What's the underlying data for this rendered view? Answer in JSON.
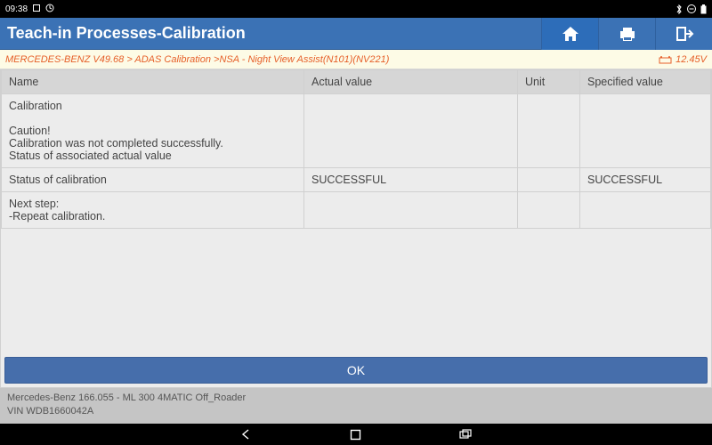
{
  "status_bar": {
    "time": "09:38",
    "bluetooth": true,
    "dnd": true,
    "battery": true
  },
  "title_bar": {
    "title": "Teach-in Processes-Calibration"
  },
  "breadcrumb": {
    "path": "MERCEDES-BENZ V49.68 > ADAS Calibration >NSA - Night View Assist(N101)(NV221)",
    "voltage": "12.45V"
  },
  "table": {
    "headers": {
      "name": "Name",
      "actual": "Actual value",
      "unit": "Unit",
      "spec": "Specified value"
    },
    "rows": [
      {
        "name": "Calibration\n\nCaution!\nCalibration was not completed successfully.\nStatus of associated actual value",
        "actual": "",
        "unit": "",
        "spec": ""
      },
      {
        "name": "Status of calibration",
        "actual": "SUCCESSFUL",
        "unit": "",
        "spec": "SUCCESSFUL"
      },
      {
        "name": "Next step:\n-Repeat calibration.",
        "actual": "",
        "unit": "",
        "spec": ""
      }
    ]
  },
  "buttons": {
    "ok": "OK"
  },
  "vehicle": {
    "line1": "Mercedes-Benz 166.055 - ML 300 4MATIC Off_Roader",
    "line2": "VIN WDB1660042A"
  }
}
